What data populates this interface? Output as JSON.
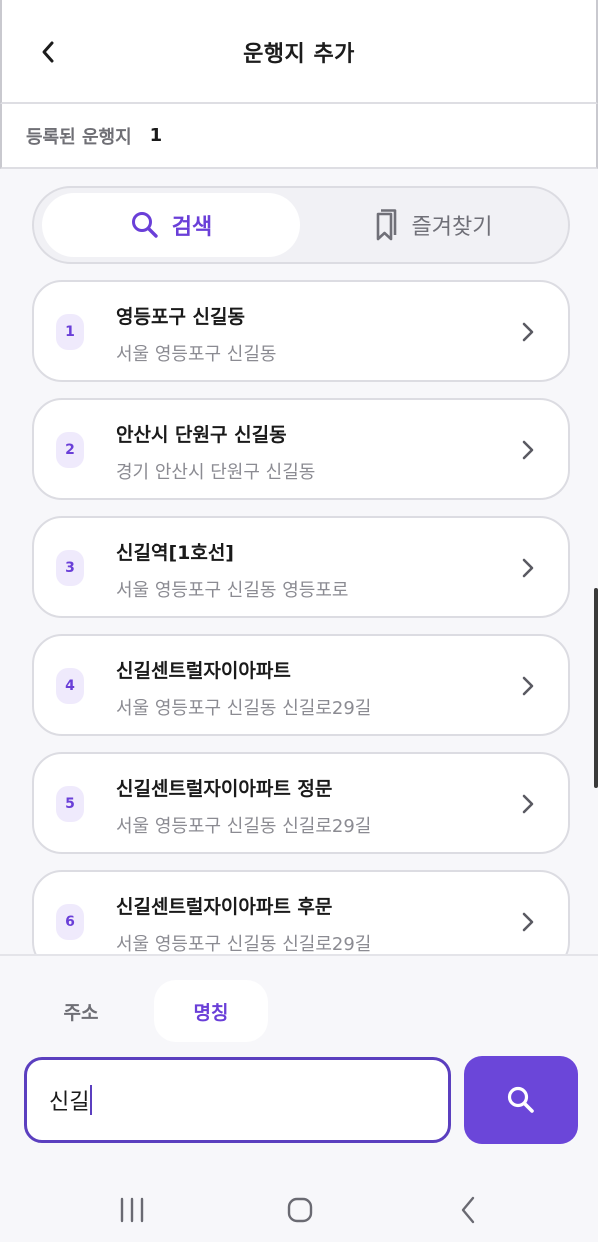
{
  "header": {
    "title": "운행지 추가",
    "back_icon": "chevron-left-icon"
  },
  "registered": {
    "label": "등록된 운행지",
    "count": "1"
  },
  "segments": [
    {
      "label": "검색",
      "icon": "search-icon",
      "active": true
    },
    {
      "label": "즐겨찾기",
      "icon": "bookmark-icon",
      "active": false
    }
  ],
  "results": [
    {
      "index": "1",
      "name": "영등포구 신길동",
      "address": "서울 영등포구 신길동"
    },
    {
      "index": "2",
      "name": "안산시 단원구 신길동",
      "address": "경기 안산시 단원구 신길동"
    },
    {
      "index": "3",
      "name": "신길역[1호선]",
      "address": "서울 영등포구 신길동 영등포로"
    },
    {
      "index": "4",
      "name": "신길센트럴자이아파트",
      "address": "서울 영등포구 신길동 신길로29길"
    },
    {
      "index": "5",
      "name": "신길센트럴자이아파트 정문",
      "address": "서울 영등포구 신길동 신길로29길"
    },
    {
      "index": "6",
      "name": "신길센트럴자이아파트 후문",
      "address": "서울 영등포구 신길동 신길로29길"
    }
  ],
  "search_modes": [
    {
      "label": "주소",
      "active": false
    },
    {
      "label": "명칭",
      "active": true
    }
  ],
  "search": {
    "value": "신길",
    "button_icon": "search-icon"
  },
  "system_nav": {
    "recents_icon": "recents-icon",
    "home_icon": "home-icon",
    "back_icon": "back-icon"
  },
  "colors": {
    "accent": "#6a3fd8",
    "accent_button": "#6b46d9",
    "index_badge_bg": "#efeafc",
    "background": "#f7f7fa"
  }
}
